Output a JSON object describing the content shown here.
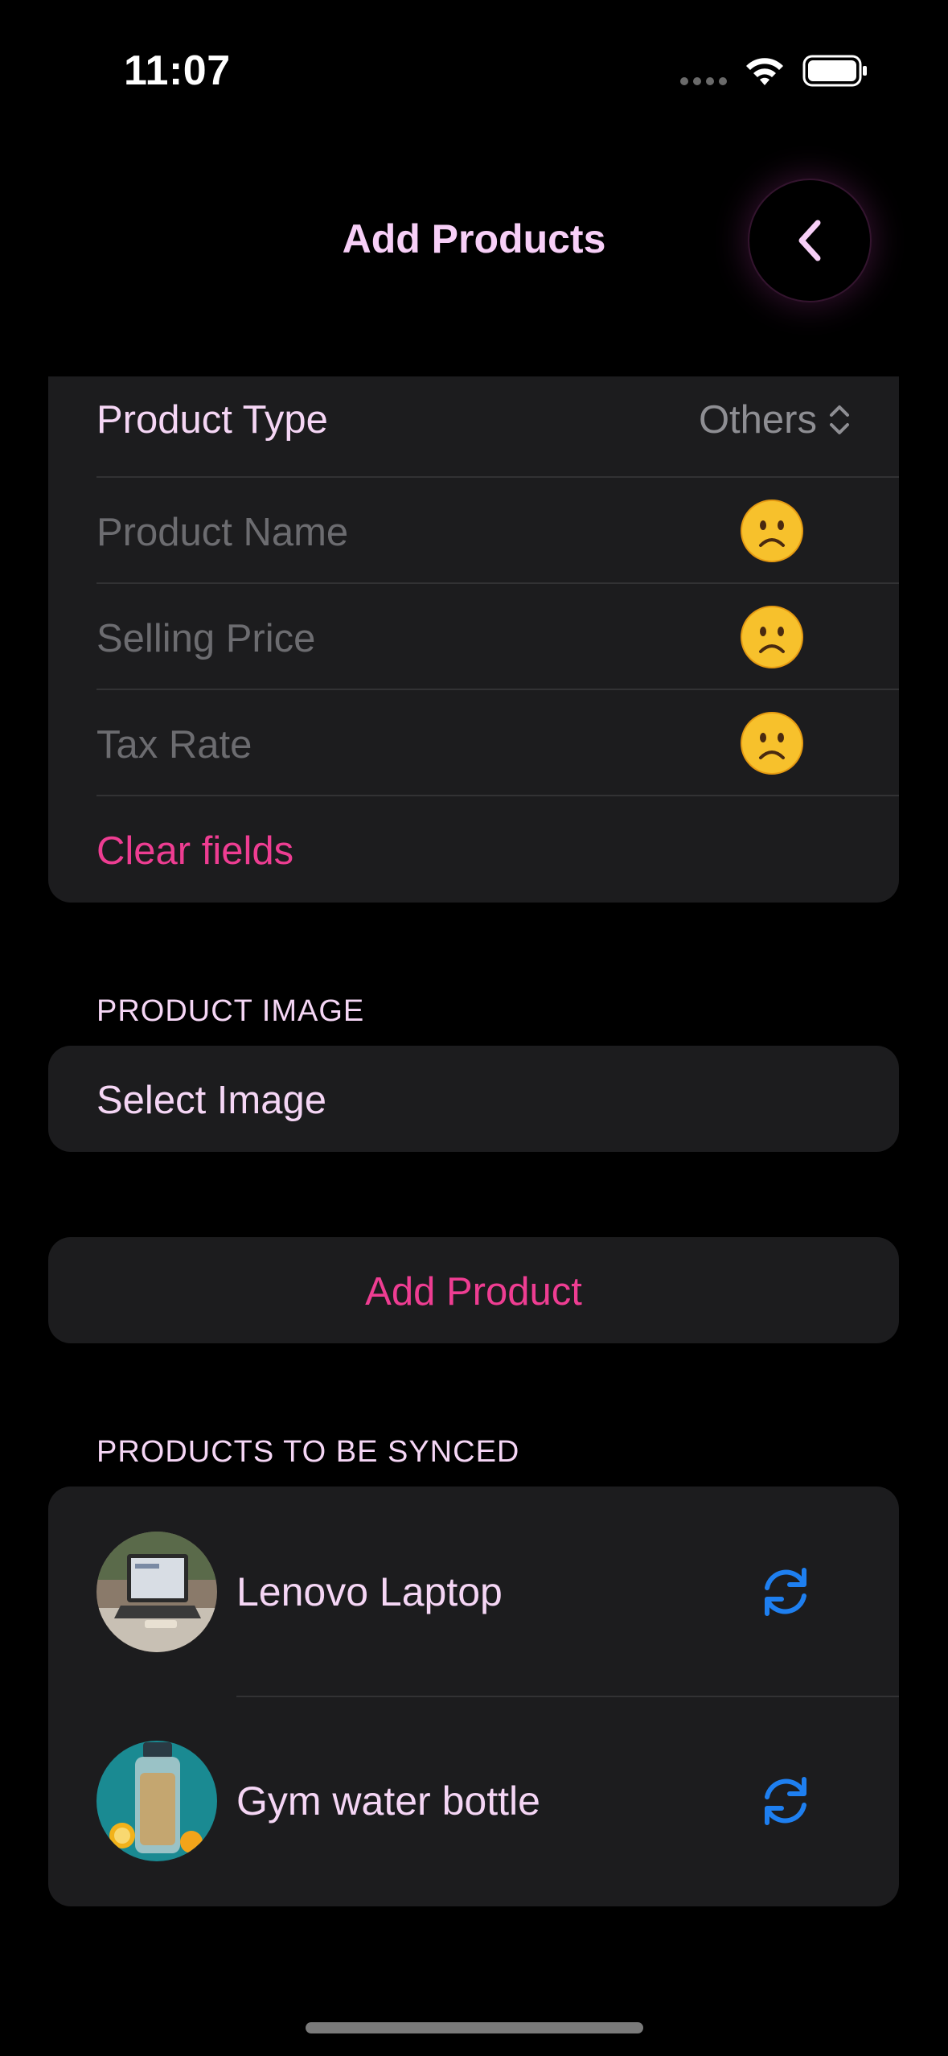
{
  "status_bar": {
    "time": "11:07"
  },
  "nav": {
    "title": "Add Products",
    "back_icon": "chevron-left-icon"
  },
  "form": {
    "product_type_label": "Product Type",
    "product_type_value": "Others",
    "fields": [
      {
        "placeholder": "Product Name",
        "status_icon": "frowning-face-icon"
      },
      {
        "placeholder": "Selling Price",
        "status_icon": "frowning-face-icon"
      },
      {
        "placeholder": "Tax Rate",
        "status_icon": "frowning-face-icon"
      }
    ],
    "clear_label": "Clear fields"
  },
  "image_section": {
    "header": "PRODUCT IMAGE",
    "select_label": "Select Image"
  },
  "add_button": {
    "label": "Add Product"
  },
  "sync_section": {
    "header": "PRODUCTS TO BE SYNCED",
    "items": [
      {
        "name": "Lenovo Laptop",
        "icon": "sync-icon"
      },
      {
        "name": "Gym water bottle",
        "icon": "sync-icon"
      }
    ]
  },
  "colors": {
    "accent": "#ee3d92",
    "title": "#f7cff7",
    "card": "#1c1c1e",
    "sync": "#1e7ff0"
  }
}
